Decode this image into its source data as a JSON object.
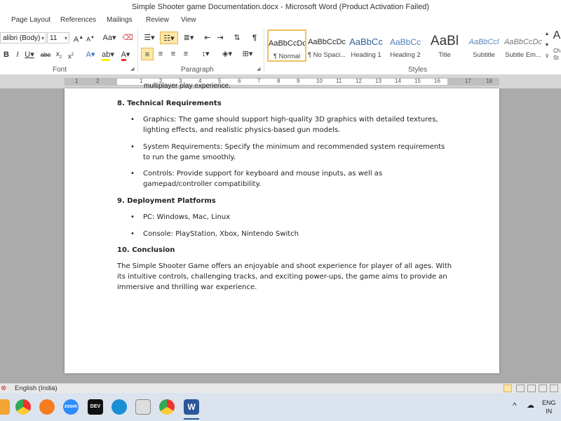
{
  "window": {
    "title": "Simple Shooter game Documentation.docx  -  Microsoft Word (Product Activation Failed)"
  },
  "menu": [
    {
      "label": "Page Layout"
    },
    {
      "label": "References"
    },
    {
      "label": "Mailings"
    },
    {
      "label": "Review"
    },
    {
      "label": "View"
    }
  ],
  "ribbon": {
    "font": {
      "name": "alibri (Body)",
      "size": "11",
      "group_label": "Font"
    },
    "paragraph": {
      "group_label": "Paragraph"
    },
    "styles": {
      "group_label": "Styles",
      "items": [
        {
          "preview": "AaBbCcDc",
          "name": "¶ Normal"
        },
        {
          "preview": "AaBbCcDc",
          "name": "¶ No Spaci..."
        },
        {
          "preview": "AaBbCc",
          "name": "Heading 1"
        },
        {
          "preview": "AaBbCc",
          "name": "Heading 2"
        },
        {
          "preview": "AaBl",
          "name": "Title"
        },
        {
          "preview": "AaBbCcl",
          "name": "Subtitle"
        },
        {
          "preview": "AaBbCcDc",
          "name": "Subtle Em..."
        }
      ],
      "change_partial": "Ch St"
    }
  },
  "ruler": {
    "numbers": [
      "1",
      "2",
      "1",
      "2",
      "3",
      "4",
      "5",
      "6",
      "7",
      "8",
      "9",
      "10",
      "11",
      "12",
      "13",
      "14",
      "15",
      "16",
      "17",
      "18"
    ]
  },
  "document": {
    "clipped_line": "multiplayer play experience.",
    "sections": [
      {
        "heading": "8. Technical Requirements",
        "bullets": [
          "Graphics: The game should support high-quality 3D graphics with detailed textures, lighting effects, and realistic physics-based gun models.",
          "System Requirements: Specify the minimum and recommended system requirements to run the game smoothly.",
          "Controls: Provide support for keyboard and mouse inputs, as well as gamepad/controller compatibility."
        ]
      },
      {
        "heading": "9. Deployment Platforms",
        "bullets": [
          "PC: Windows, Mac, Linux",
          "Console: PlayStation, Xbox, Nintendo Switch"
        ]
      },
      {
        "heading": "10. Conclusion",
        "paragraph": "The Simple Shooter Game offers an enjoyable and shoot experience for player of all ages. With its intuitive controls, challenging tracks, and exciting power-ups, the game aims to provide an immersive and thrilling war experience."
      }
    ]
  },
  "status": {
    "language": "English (India)"
  },
  "taskbar": {
    "zoom_label": "zoom",
    "dev_label": "DEV",
    "word_label": "W",
    "lang_top": "ENG",
    "lang_bottom": "IN"
  },
  "colors": {
    "accent": "#2b579a",
    "selected_button": "#fde7a6",
    "page": "#ffffff",
    "workspace": "#ababab"
  }
}
